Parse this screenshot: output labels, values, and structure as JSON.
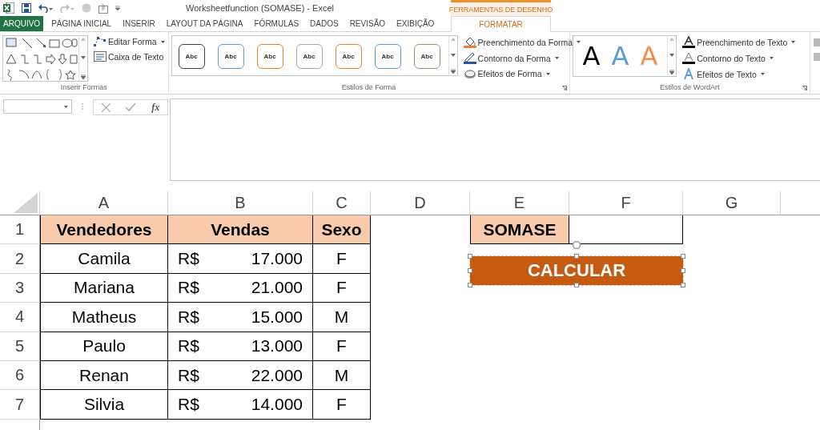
{
  "window": {
    "title": "Worksheetfunction (SOMASE) - Excel"
  },
  "contextual_tab_group": {
    "label": "FERRAMENTAS DE DESENHO"
  },
  "ribbon_tabs": [
    {
      "label": "ARQUIVO",
      "kind": "file",
      "selected": false
    },
    {
      "label": "PÁGINA INICIAL",
      "kind": "tab",
      "selected": false
    },
    {
      "label": "INSERIR",
      "kind": "tab",
      "selected": false
    },
    {
      "label": "LAYOUT DA PÁGINA",
      "kind": "tab",
      "selected": false
    },
    {
      "label": "FÓRMULAS",
      "kind": "tab",
      "selected": false
    },
    {
      "label": "DADOS",
      "kind": "tab",
      "selected": false
    },
    {
      "label": "REVISÃO",
      "kind": "tab",
      "selected": false
    },
    {
      "label": "EXIBIÇÃO",
      "kind": "tab",
      "selected": false
    },
    {
      "label": "FORMATAR",
      "kind": "contextual",
      "selected": true
    }
  ],
  "ribbon": {
    "insert_shapes": {
      "title": "Inserir Formas",
      "buttons": [
        {
          "label": "Editar Forma",
          "kind": "edit-shape",
          "dropdown": true
        },
        {
          "label": "Caixa de Texto",
          "kind": "text-box",
          "dropdown": false
        }
      ]
    },
    "shape_styles": {
      "title": "Estilos de Forma",
      "swatches": [
        {
          "label": "Abc",
          "color": "#404040"
        },
        {
          "label": "Abc",
          "color": "#5b9bd5"
        },
        {
          "label": "Abc",
          "color": "#ed7d31"
        },
        {
          "label": "Abc",
          "color": "#a5a5a5"
        },
        {
          "label": "Abc",
          "color": "#ed7d31"
        },
        {
          "label": "Abc",
          "color": "#5b9bd5"
        },
        {
          "label": "Abc",
          "color": "#a58f72"
        }
      ],
      "buttons": [
        {
          "label": "Preenchimento da Forma",
          "kind": "fill",
          "dropdown": true
        },
        {
          "label": "Contorno da Forma",
          "kind": "outline",
          "dropdown": true
        },
        {
          "label": "Efeitos de Forma",
          "kind": "effects",
          "dropdown": true
        }
      ]
    },
    "wordart_styles": {
      "title": "Estilos de WordArt",
      "samples": [
        {
          "label": "A",
          "color": "#000000",
          "kind": "solid"
        },
        {
          "label": "A",
          "color": "#5b9bd5",
          "kind": "solid"
        },
        {
          "label": "A",
          "color": "#ed7d31",
          "kind": "outline"
        }
      ],
      "buttons": [
        {
          "label": "Preenchimento de Texto",
          "kind": "text-fill",
          "dropdown": true
        },
        {
          "label": "Contorno do Texto",
          "kind": "text-outline",
          "dropdown": true
        },
        {
          "label": "Efeitos de Texto",
          "kind": "text-effects",
          "dropdown": true
        }
      ]
    }
  },
  "formula_bar": {
    "function_label": "fx"
  },
  "sheet": {
    "columns": [
      "A",
      "B",
      "C",
      "D",
      "E",
      "F",
      "G"
    ],
    "row_numbers": [
      "1",
      "2",
      "3",
      "4",
      "5",
      "6",
      "7"
    ],
    "table": {
      "header": [
        "Vendedores",
        "Vendas",
        "Sexo"
      ],
      "rows": [
        {
          "vendedor": "Camila",
          "currency": "R$",
          "vendas": "17.000",
          "sexo": "F"
        },
        {
          "vendedor": "Mariana",
          "currency": "R$",
          "vendas": "21.000",
          "sexo": "F"
        },
        {
          "vendedor": "Matheus",
          "currency": "R$",
          "vendas": "15.000",
          "sexo": "M"
        },
        {
          "vendedor": "Paulo",
          "currency": "R$",
          "vendas": "13.000",
          "sexo": "F"
        },
        {
          "vendedor": "Renan",
          "currency": "R$",
          "vendas": "22.000",
          "sexo": "M"
        },
        {
          "vendedor": "Silvia",
          "currency": "R$",
          "vendas": "14.000",
          "sexo": "F"
        }
      ]
    },
    "criteria_label": "SOMASE",
    "shape_button": {
      "label": "CALCULAR",
      "selected": true
    }
  }
}
